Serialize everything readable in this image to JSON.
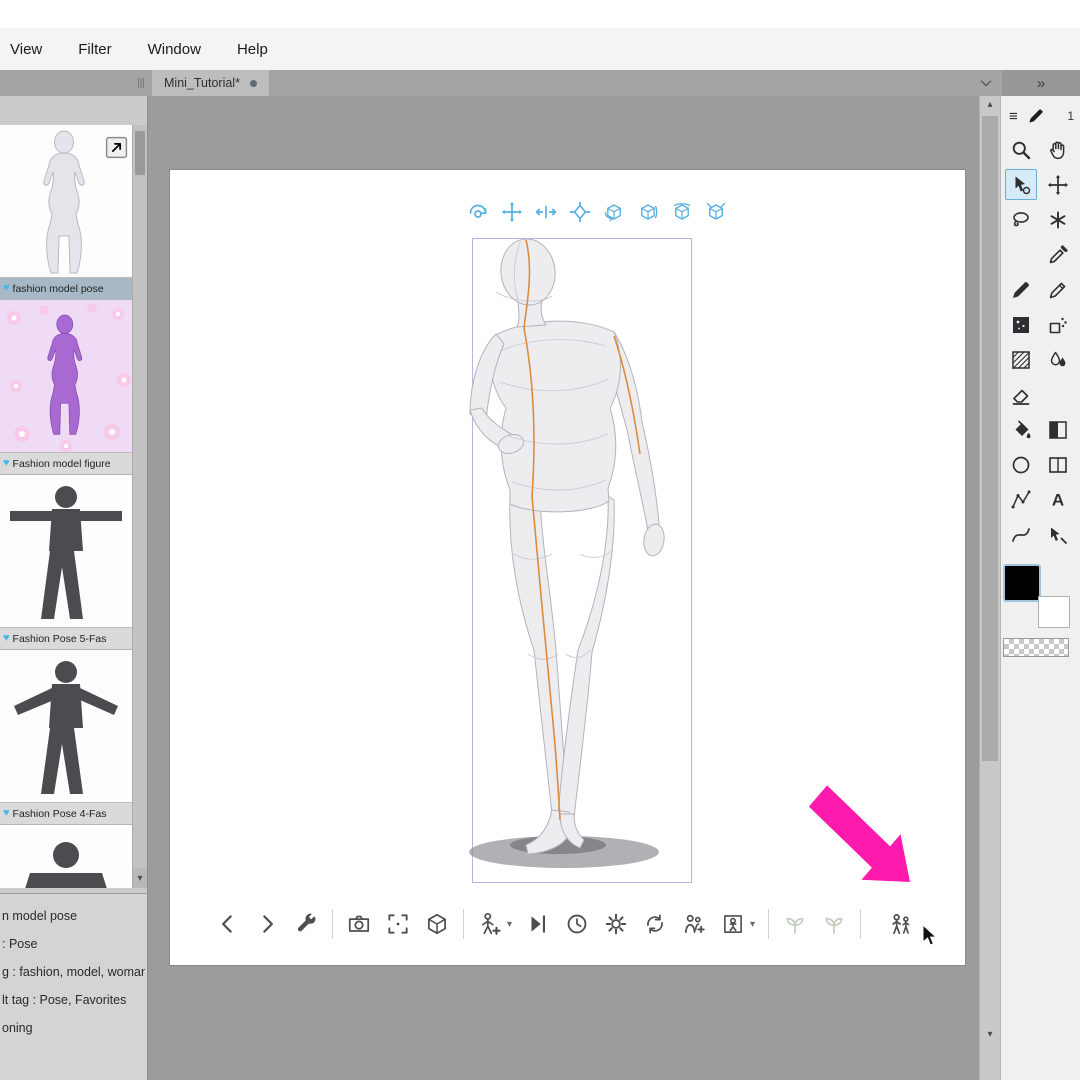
{
  "colors": {
    "accent_blue": "#57b0e0",
    "heart_blue": "#45b7ec",
    "arrow_pink": "#ff1aae",
    "selected_tool_border": "#6aaed6",
    "main_color": "#000000",
    "sub_color": "#ffffff"
  },
  "menu": {
    "items": [
      "View",
      "Filter",
      "Window",
      "Help"
    ]
  },
  "tab_bar": {
    "tab_title": "Mini_Tutorial*",
    "modified": true,
    "overflow_glyph": "»"
  },
  "materials_panel": {
    "items": [
      {
        "label": "fashion model pose",
        "thumb": "female-figure",
        "selected": true,
        "has_export_icon": true
      },
      {
        "label": "Fashion model figure",
        "thumb": "purple-figure",
        "selected": false
      },
      {
        "label": "Fashion Pose 5-Fas",
        "thumb": "tpose-straight",
        "selected": false
      },
      {
        "label": "Fashion Pose 4-Fas",
        "thumb": "tpose-angled",
        "selected": false
      },
      {
        "label": "",
        "thumb": "partial-dark",
        "selected": false,
        "partial": true
      }
    ],
    "info_lines": [
      "n model pose",
      ": Pose",
      "g : fashion, model, woman, girl",
      "lt tag : Pose, Favorites",
      "oning"
    ]
  },
  "canvas": {
    "nav_icons": [
      "camera-rotate",
      "camera-pan",
      "camera-zoom",
      "object-move",
      "cube-rotate-y",
      "cube-rotate-x",
      "cube-rotate-z",
      "cube-free"
    ],
    "bottom_toolbar": [
      {
        "name": "chevron-left"
      },
      {
        "name": "chevron-right"
      },
      {
        "name": "wrench"
      },
      {
        "sep": true
      },
      {
        "name": "camera"
      },
      {
        "name": "crop-frame"
      },
      {
        "name": "cube"
      },
      {
        "sep": true
      },
      {
        "name": "figure-add",
        "caret": true
      },
      {
        "name": "skip-end"
      },
      {
        "name": "clock"
      },
      {
        "name": "gear"
      },
      {
        "name": "rotate-cycle"
      },
      {
        "name": "people-add"
      },
      {
        "name": "box-figure",
        "caret": true
      },
      {
        "sep": true
      },
      {
        "name": "plant-left",
        "disabled": true
      },
      {
        "name": "plant-right",
        "disabled": true
      },
      {
        "sep": true
      },
      {
        "name": "people-pair",
        "target": true
      }
    ]
  },
  "right_palette": {
    "header_number": "1",
    "selected_tool": "object-select",
    "tool_rows": [
      [
        "magnifier",
        "hand"
      ],
      [
        "object-select",
        "move"
      ],
      [
        "lasso",
        "asterisk"
      ],
      [
        null,
        "eyedropper"
      ],
      [
        "pen",
        "pencil"
      ],
      [
        "dark-brush",
        "decoration"
      ],
      [
        "hatch",
        "blend"
      ],
      [
        "eraser",
        null
      ],
      [
        "bucket",
        "gradient"
      ],
      [
        "circle-shape",
        "frame-tool"
      ],
      [
        "polyline",
        "text-tool"
      ],
      [
        "curve",
        "flow-select"
      ]
    ]
  }
}
